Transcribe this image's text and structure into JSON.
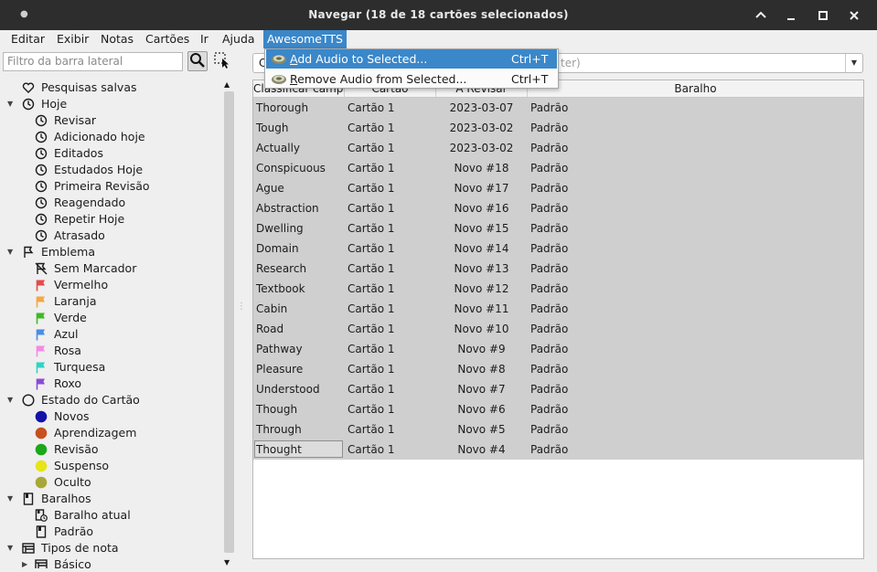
{
  "window": {
    "title": "Navegar (18 de 18 cartões selecionados)"
  },
  "menubar": [
    {
      "label": "Editar"
    },
    {
      "label": "Exibir"
    },
    {
      "label": "Notas"
    },
    {
      "label": "Cartões"
    },
    {
      "label": "Ir"
    },
    {
      "label": "Ajuda"
    },
    {
      "label": "AwesomeTTS"
    }
  ],
  "awesometts_menu": {
    "items": [
      {
        "label": "Add Audio to Selected...",
        "shortcut": "Ctrl+T",
        "highlighted": true
      },
      {
        "label": "Remove Audio from Selected...",
        "shortcut": "Ctrl+T",
        "highlighted": false
      }
    ]
  },
  "sidebar": {
    "search_placeholder": "Filtro da barra lateral",
    "tree": [
      {
        "label": "Pesquisas salvas",
        "icon": "heart-icon",
        "level": 0,
        "arrow": ""
      },
      {
        "label": "Hoje",
        "icon": "clock-icon",
        "level": 0,
        "arrow": "down"
      },
      {
        "label": "Revisar",
        "icon": "clock-icon",
        "level": 1
      },
      {
        "label": "Adicionado hoje",
        "icon": "clock-icon",
        "level": 1
      },
      {
        "label": "Editados",
        "icon": "clock-icon",
        "level": 1
      },
      {
        "label": "Estudados Hoje",
        "icon": "clock-icon",
        "level": 1
      },
      {
        "label": "Primeira Revisão",
        "icon": "clock-icon",
        "level": 1
      },
      {
        "label": "Reagendado",
        "icon": "clock-icon",
        "level": 1
      },
      {
        "label": "Repetir Hoje",
        "icon": "clock-icon",
        "level": 1
      },
      {
        "label": "Atrasado",
        "icon": "clock-icon",
        "level": 1
      },
      {
        "label": "Emblema",
        "icon": "flag-outline-icon",
        "level": 0,
        "arrow": "down"
      },
      {
        "label": "Sem Marcador",
        "icon": "flag-off-icon",
        "level": 1
      },
      {
        "label": "Vermelho",
        "icon": "flag-icon",
        "color": "#e64a4a",
        "level": 1
      },
      {
        "label": "Laranja",
        "icon": "flag-icon",
        "color": "#f5a742",
        "level": 1
      },
      {
        "label": "Verde",
        "icon": "flag-icon",
        "color": "#3cba21",
        "level": 1
      },
      {
        "label": "Azul",
        "icon": "flag-icon",
        "color": "#4a8de6",
        "level": 1
      },
      {
        "label": "Rosa",
        "icon": "flag-icon",
        "color": "#f58ae6",
        "level": 1
      },
      {
        "label": "Turquesa",
        "icon": "flag-icon",
        "color": "#2fd4c4",
        "level": 1
      },
      {
        "label": "Roxo",
        "icon": "flag-icon",
        "color": "#8a4ad6",
        "level": 1
      },
      {
        "label": "Estado do Cartão",
        "icon": "circle-outline-icon",
        "level": 0,
        "arrow": "down"
      },
      {
        "label": "Novos",
        "icon": "dot-icon",
        "color": "#1212a8",
        "level": 1
      },
      {
        "label": "Aprendizagem",
        "icon": "dot-icon",
        "color": "#c8501e",
        "level": 1
      },
      {
        "label": "Revisão",
        "icon": "dot-icon",
        "color": "#1aa81a",
        "level": 1
      },
      {
        "label": "Suspenso",
        "icon": "dot-icon",
        "color": "#e5e51a",
        "level": 1
      },
      {
        "label": "Oculto",
        "icon": "dot-icon",
        "color": "#a8a838",
        "level": 1
      },
      {
        "label": "Baralhos",
        "icon": "deck-icon",
        "level": 0,
        "arrow": "down"
      },
      {
        "label": "Baralho atual",
        "icon": "deck-clock-icon",
        "level": 1
      },
      {
        "label": "Padrão",
        "icon": "deck-icon",
        "level": 1
      },
      {
        "label": "Tipos de nota",
        "icon": "notetype-icon",
        "level": 0,
        "arrow": "down"
      },
      {
        "label": "Básico",
        "icon": "notetype-icon",
        "level": 1,
        "arrow": "right"
      }
    ]
  },
  "main": {
    "search_placeholder_fragment": "ter)",
    "search_prefix": "C",
    "columns": [
      {
        "label": "Classificar campo"
      },
      {
        "label": "Cartão"
      },
      {
        "label": "A Revisar"
      },
      {
        "label": "Baralho"
      }
    ],
    "rows": [
      [
        "Thorough",
        "Cartão 1",
        "2023-03-07",
        "Padrão"
      ],
      [
        "Tough",
        "Cartão 1",
        "2023-03-02",
        "Padrão"
      ],
      [
        "Actually",
        "Cartão 1",
        "2023-03-02",
        "Padrão"
      ],
      [
        "Conspicuous",
        "Cartão 1",
        "Novo #18",
        "Padrão"
      ],
      [
        "Ague",
        "Cartão 1",
        "Novo #17",
        "Padrão"
      ],
      [
        "Abstraction",
        "Cartão 1",
        "Novo #16",
        "Padrão"
      ],
      [
        "Dwelling",
        "Cartão 1",
        "Novo #15",
        "Padrão"
      ],
      [
        "Domain",
        "Cartão 1",
        "Novo #14",
        "Padrão"
      ],
      [
        "Research",
        "Cartão 1",
        "Novo #13",
        "Padrão"
      ],
      [
        "Textbook",
        "Cartão 1",
        "Novo #12",
        "Padrão"
      ],
      [
        "Cabin",
        "Cartão 1",
        "Novo #11",
        "Padrão"
      ],
      [
        "Road",
        "Cartão 1",
        "Novo #10",
        "Padrão"
      ],
      [
        "Pathway",
        "Cartão 1",
        "Novo #9",
        "Padrão"
      ],
      [
        "Pleasure",
        "Cartão 1",
        "Novo #8",
        "Padrão"
      ],
      [
        "Understood",
        "Cartão 1",
        "Novo #7",
        "Padrão"
      ],
      [
        "Though",
        "Cartão 1",
        "Novo #6",
        "Padrão"
      ],
      [
        "Through",
        "Cartão 1",
        "Novo #5",
        "Padrão"
      ],
      [
        "Thought",
        "Cartão 1",
        "Novo #4",
        "Padrão"
      ]
    ]
  }
}
